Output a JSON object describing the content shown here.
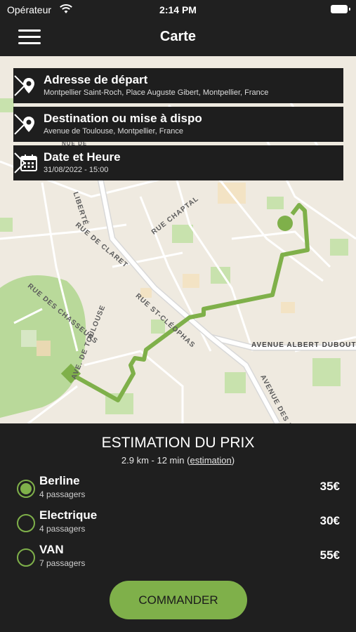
{
  "status_bar": {
    "carrier": "Opérateur",
    "time": "2:14 PM"
  },
  "nav": {
    "title": "Carte"
  },
  "cards": [
    {
      "title": "Adresse de départ",
      "subtitle": "Montpellier Saint-Roch, Place Auguste Gibert, Montpellier, France",
      "icon": "location-pin-icon"
    },
    {
      "title": "Destination ou mise à dispo",
      "subtitle": "Avenue de Toulouse, Montpellier, France",
      "icon": "location-pin-icon"
    },
    {
      "title": "Date et Heure",
      "subtitle": "31/08/2022 - 15:00",
      "icon": "calendar-icon"
    }
  ],
  "map": {
    "streets": {
      "liberte": "LIBERTÉ",
      "claret": "RUE DE CLARET",
      "chaptal": "RUE CHAPTAL",
      "st_cleophas": "RUE ST-CLÉOPHAS",
      "chasseurs": "RUE DES CHASSEURS",
      "toulouse": "AVE. DE TOULOUSE",
      "albert_dubout": "AVENUE ALBERT DUBOUT",
      "avenue_des": "AVENUE DES P",
      "top_fragment": "NUE DE"
    },
    "route_color": "#7fb04a"
  },
  "estimate": {
    "title": "ESTIMATION DU PRIX",
    "summary": "2.9 km - 12 min",
    "link": "estimation",
    "options": [
      {
        "name": "Berline",
        "passengers": "4 passagers",
        "price": "35€",
        "selected": true
      },
      {
        "name": "Electrique",
        "passengers": "4 passagers",
        "price": "30€",
        "selected": false
      },
      {
        "name": "VAN",
        "passengers": "7 passagers",
        "price": "55€",
        "selected": false
      }
    ],
    "order_label": "COMMANDER"
  },
  "colors": {
    "accent": "#7fb04a",
    "panel": "#1f1f1f"
  }
}
